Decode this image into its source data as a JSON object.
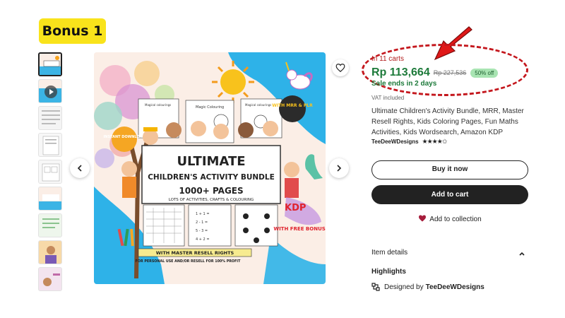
{
  "badge": {
    "label": "Bonus 1",
    "color": "#f9e31b"
  },
  "product": {
    "in_carts": "In 11 carts",
    "price": "Rp 113,664",
    "old_price": "Rp 227,536",
    "discount": "50% off",
    "sale_ends": "Sale ends in 2 days",
    "vat": "VAT included",
    "title": "Ultimate Children's Activity Bundle, MRR, Master Resell Rights, Kids Coloring Pages, Fun Maths Activities, Kids Wordsearch, Amazon KDP",
    "shop": "TeeDeeWDesigns",
    "rating_stars": "★★★★✩",
    "rating": 4.5
  },
  "actions": {
    "buy_now": "Buy it now",
    "add_to_cart": "Add to cart",
    "add_to_collection": "Add to collection"
  },
  "details": {
    "item_details": "Item details",
    "highlights": "Highlights",
    "designed_by_label": "Designed by",
    "designer": "TeeDeeWDesigns"
  },
  "image_text": {
    "ultimate": "ULTIMATE",
    "bundle": "CHILDREN'S ACTIVITY BUNDLE",
    "pages": "1000+ PAGES",
    "sub": "LOTS OF ACTIVITIES, CRAFTS & COLOURING",
    "instant": "INSTANT DOWNLOAD",
    "mrr": "WITH MRR & PLR",
    "kdp": "KDP",
    "free": "WITH FREE BONUSES",
    "master": "WITH MASTER RESELL RIGHTS",
    "personal": "FOR PERSONAL USE AND/OR RESELL FOR 100% PROFIT",
    "magical": "Magical colourings",
    "magic": "Magic Colouring",
    "magical2": "Magical colourings",
    "math_lines": [
      "1 + 1 =",
      "2 - 1 =",
      "5 - 3 =",
      "4 + 2 ="
    ]
  },
  "colors": {
    "price_green": "#1d7a3a",
    "carts_red": "#b11a1a",
    "annotation_red": "#c4171d",
    "discount_bg": "#a8e4b2"
  },
  "icons": [
    "play-icon",
    "chevron-left-icon",
    "chevron-right-icon",
    "heart-outline-icon",
    "heart-filled-icon",
    "chevron-up-icon",
    "designed-by-icon",
    "red-arrow-annotation"
  ]
}
